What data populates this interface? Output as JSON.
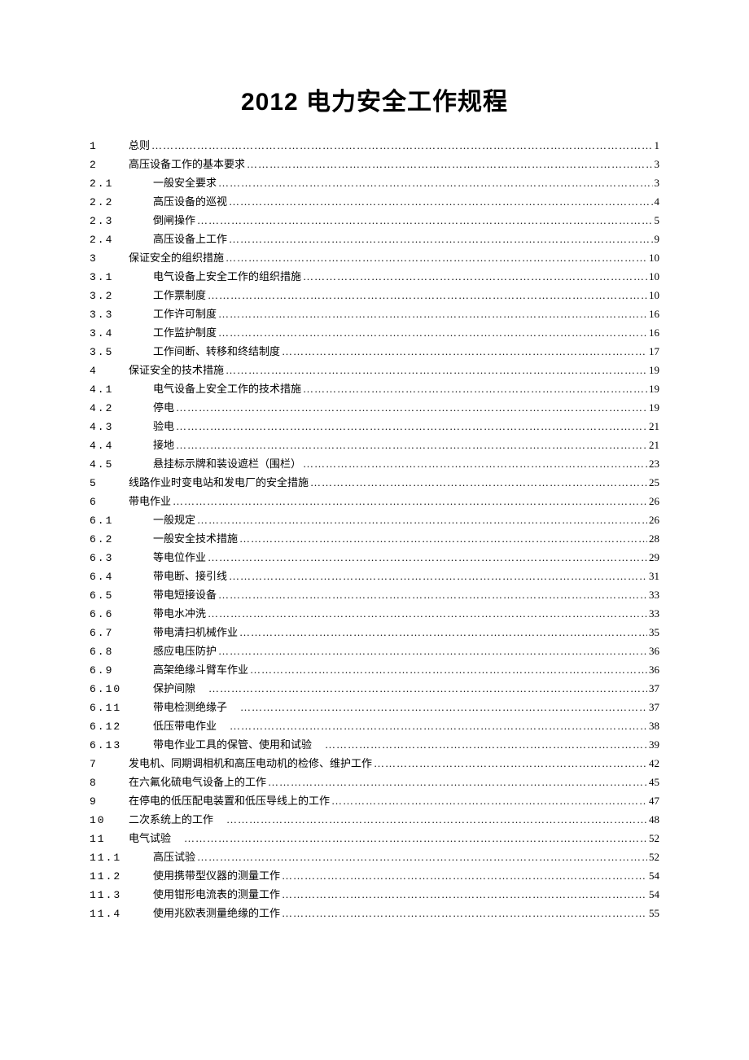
{
  "title": "2012 电力安全工作规程",
  "toc": [
    {
      "num": "1",
      "level": 1,
      "title": "总则",
      "page": "1"
    },
    {
      "num": "2",
      "level": 1,
      "title": "高压设备工作的基本要求",
      "page": "3"
    },
    {
      "num": "2.1",
      "level": 2,
      "title": "一般安全要求",
      "page": "3"
    },
    {
      "num": "2.2",
      "level": 2,
      "title": "高压设备的巡视",
      "page": "4"
    },
    {
      "num": "2.3",
      "level": 2,
      "title": "倒闸操作",
      "page": "5"
    },
    {
      "num": "2.4",
      "level": 2,
      "title": "高压设备上工作",
      "page": "9"
    },
    {
      "num": "3",
      "level": 1,
      "title": "保证安全的组织措施",
      "page": "10"
    },
    {
      "num": "3.1",
      "level": 2,
      "title": "电气设备上安全工作的组织措施",
      "page": "10"
    },
    {
      "num": "3.2",
      "level": 2,
      "title": "工作票制度",
      "page": "10"
    },
    {
      "num": "3.3",
      "level": 2,
      "title": "工作许可制度",
      "page": "16"
    },
    {
      "num": "3.4",
      "level": 2,
      "title": "工作监护制度",
      "page": "16"
    },
    {
      "num": "3.5",
      "level": 2,
      "title": "工作间断、转移和终结制度",
      "page": "17"
    },
    {
      "num": "4",
      "level": 1,
      "title": "保证安全的技术措施",
      "page": "19"
    },
    {
      "num": "4.1",
      "level": 2,
      "title": "电气设备上安全工作的技术措施",
      "page": "19"
    },
    {
      "num": "4.2",
      "level": 2,
      "title": "停电",
      "page": "19"
    },
    {
      "num": "4.3",
      "level": 2,
      "title": "验电",
      "page": "21"
    },
    {
      "num": "4.4",
      "level": 2,
      "title": "接地",
      "page": "21"
    },
    {
      "num": "4.5",
      "level": 2,
      "title": "悬挂标示牌和装设遮栏（围栏）",
      "page": "23"
    },
    {
      "num": "5",
      "level": 1,
      "title": "线路作业时变电站和发电厂的安全措施",
      "page": "25"
    },
    {
      "num": "6",
      "level": 1,
      "title": "带电作业",
      "page": "26"
    },
    {
      "num": "6.1",
      "level": 2,
      "title": "一般规定",
      "page": "26"
    },
    {
      "num": "6.2",
      "level": 2,
      "title": "一般安全技术措施",
      "page": "28"
    },
    {
      "num": "6.3",
      "level": 2,
      "title": "等电位作业",
      "page": "29"
    },
    {
      "num": "6.4",
      "level": 2,
      "title": "带电断、接引线",
      "page": "31"
    },
    {
      "num": "6.5",
      "level": 2,
      "title": "带电短接设备",
      "page": "33"
    },
    {
      "num": "6.6",
      "level": 2,
      "title": "带电水冲洗",
      "page": "33"
    },
    {
      "num": "6.7",
      "level": 2,
      "title": "带电清扫机械作业",
      "page": "35"
    },
    {
      "num": "6.8",
      "level": 2,
      "title": "感应电压防护",
      "page": "36"
    },
    {
      "num": "6.9",
      "level": 2,
      "title": "高架绝缘斗臂车作业",
      "page": "36"
    },
    {
      "num": "6.10",
      "level": 2,
      "title": "保护间隙",
      "gap": true,
      "page": "37"
    },
    {
      "num": "6.11",
      "level": 2,
      "title": "带电检测绝缘子",
      "gap": true,
      "page": "37"
    },
    {
      "num": "6.12",
      "level": 2,
      "title": "低压带电作业",
      "gap": true,
      "page": "38"
    },
    {
      "num": "6.13",
      "level": 2,
      "title": "带电作业工具的保管、使用和试验",
      "gap": true,
      "page": "39"
    },
    {
      "num": "7",
      "level": 1,
      "title": "发电机、同期调相机和高压电动机的检修、维护工作",
      "page": "42"
    },
    {
      "num": "8",
      "level": 1,
      "title": "在六氟化硫电气设备上的工作",
      "page": "45"
    },
    {
      "num": "9",
      "level": 1,
      "title": "在停电的低压配电装置和低压导线上的工作",
      "page": "47"
    },
    {
      "num": "10",
      "level": 1,
      "title": "二次系统上的工作",
      "gap": true,
      "page": "48"
    },
    {
      "num": "11",
      "level": 1,
      "title": "电气试验",
      "gap": true,
      "page": "52"
    },
    {
      "num": "11.1",
      "level": 2,
      "title": "高压试验",
      "page": "52"
    },
    {
      "num": "11.2",
      "level": 2,
      "title": "使用携带型仪器的测量工作",
      "page": "54"
    },
    {
      "num": "11.3",
      "level": 2,
      "title": "使用钳形电流表的测量工作",
      "page": "54"
    },
    {
      "num": "11.4",
      "level": 2,
      "title": "使用兆欧表测量绝缘的工作",
      "page": "55"
    }
  ]
}
